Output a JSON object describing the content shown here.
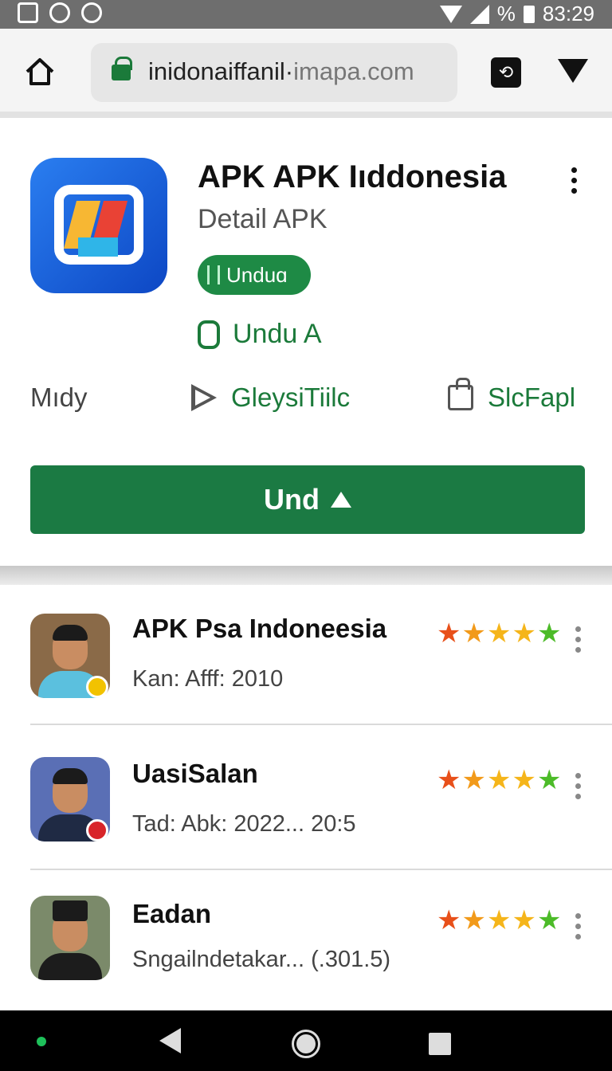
{
  "status_bar": {
    "time": "83:29",
    "battery_symbol": "%",
    "icons": [
      "image-icon",
      "sync-icon",
      "location-icon",
      "wifi-icon",
      "signal-icon",
      "battery-icon"
    ]
  },
  "browser": {
    "url_main": "inidonaiffanil·",
    "url_dim": "imapa.com"
  },
  "app": {
    "title": "APK APK Iıddonesia",
    "subtitle": "Detail APK",
    "pill_label": "Unduɑ",
    "unduh_label": "Undu A",
    "stats": [
      {
        "label": "Mıdy"
      },
      {
        "label": "GleysiTiilc"
      },
      {
        "label": "SlcFapl"
      }
    ],
    "download_button": "Und",
    "accent_color": "#1b7a43"
  },
  "list": [
    {
      "title": "APK Psa Indoneesia",
      "subtitle": "Kan: Afff: 2010",
      "rating": 5
    },
    {
      "title": "UasiSalan",
      "subtitle": "Tad: Abk: 2022... 20:5",
      "rating": 5
    },
    {
      "title": "Eadan",
      "subtitle": "Sngailndetakar... (.301.5)",
      "rating": 5
    }
  ]
}
